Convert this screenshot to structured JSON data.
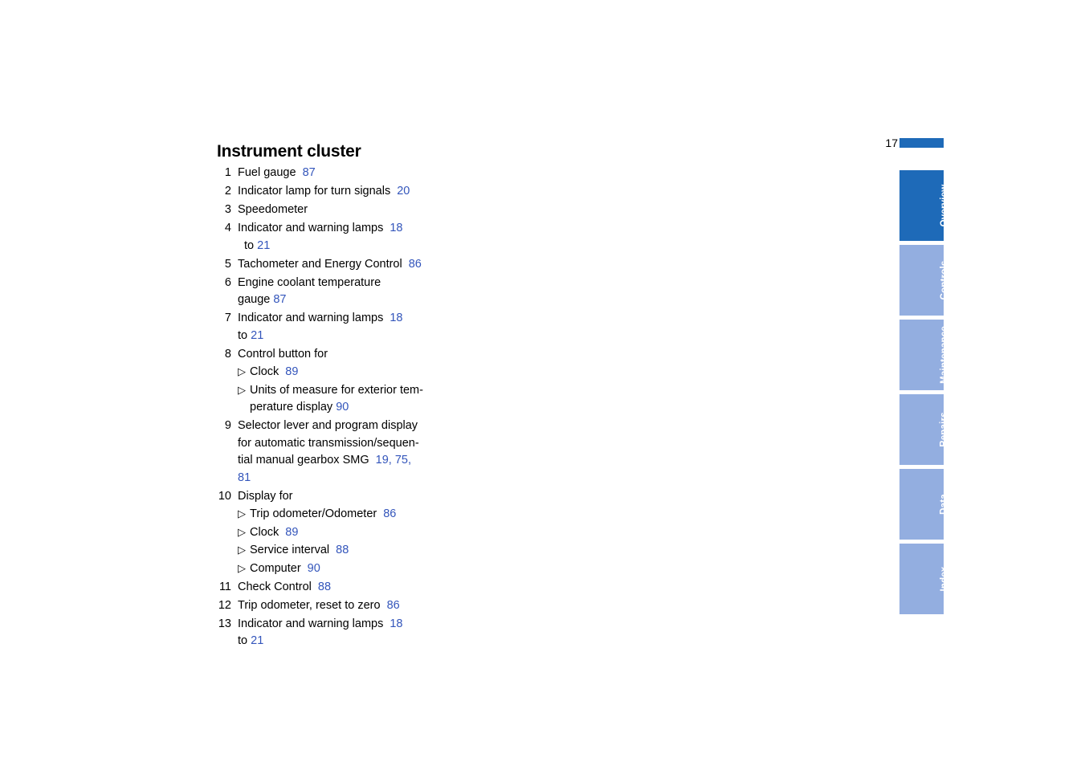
{
  "page": {
    "heading": "Instrument cluster",
    "folio": "17",
    "accent_color": "#1e6ab8",
    "tab_color": "#93aee0",
    "reference_color": "#3355bb"
  },
  "legend": {
    "items": [
      {
        "num": "1",
        "text": "Fuel gauge",
        "refs": "87"
      },
      {
        "num": "2",
        "text": "Indicator lamp for turn signals",
        "refs": "20"
      },
      {
        "num": "3",
        "text": "Speedometer",
        "refs": ""
      },
      {
        "num": "4",
        "text": "Indicator and warning lamps",
        "refs": "18",
        "cont_prefix": "to ",
        "cont_refs": "21"
      },
      {
        "num": "5",
        "text": "Tachometer and Energy Control",
        "refs": "86"
      },
      {
        "num": "6",
        "text": "Engine coolant temperature",
        "cont_prefix": "gauge ",
        "cont_refs": "87"
      },
      {
        "num": "7",
        "text": "Indicator and warning lamps",
        "refs": "18",
        "cont_prefix": "to ",
        "cont_refs": "21"
      },
      {
        "num": "8",
        "text": "Control button for",
        "subitems": [
          {
            "bullet": "▷",
            "text": "Clock",
            "refs": "89"
          },
          {
            "bullet": "▷",
            "text": "Units of measure for exterior tem-",
            "cont": "perature display ",
            "cont_refs": "90"
          }
        ]
      },
      {
        "num": "9",
        "text": "Selector lever and program display",
        "lines": [
          {
            "text": "for automatic transmission/sequen-"
          },
          {
            "text": "tial manual gearbox SMG ",
            "refs": "19, 75,"
          },
          {
            "refs": "81"
          }
        ]
      },
      {
        "num": "10",
        "text": "Display for",
        "subitems": [
          {
            "bullet": "▷",
            "text": "Trip odometer/Odometer",
            "refs": "86"
          },
          {
            "bullet": "▷",
            "text": "Clock",
            "refs": "89"
          },
          {
            "bullet": "▷",
            "text": "Service interval",
            "refs": "88"
          },
          {
            "bullet": "▷",
            "text": "Computer",
            "refs": "90"
          }
        ]
      },
      {
        "num": "11",
        "text": "Check Control",
        "refs": "88"
      },
      {
        "num": "12",
        "text": "Trip odometer, reset to zero",
        "refs": "86"
      },
      {
        "num": "13",
        "text": "Indicator and warning lamps",
        "refs": "18",
        "cont_prefix": "to ",
        "cont_refs": "21"
      }
    ]
  },
  "thumb_tabs": [
    {
      "label": "Overview",
      "active": true
    },
    {
      "label": "Controls",
      "active": false
    },
    {
      "label": "Maintenance",
      "active": false
    },
    {
      "label": "Repairs",
      "active": false
    },
    {
      "label": "Data",
      "active": false
    },
    {
      "label": "Index",
      "active": false
    }
  ]
}
